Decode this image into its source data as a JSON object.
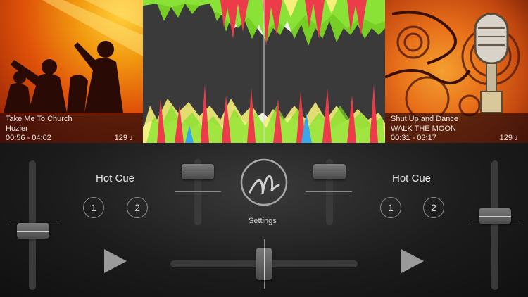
{
  "deck_left": {
    "title": "Take Me To Church",
    "artist": "Hozier",
    "time": "00:56 - 04:02",
    "bpm": "129 ♩",
    "hot_cue_label": "Hot Cue",
    "cue_1": "1",
    "cue_2": "2",
    "pitch_level": 0.45
  },
  "deck_right": {
    "title": "Shut Up and Dance",
    "artist": "WALK THE MOON",
    "time": "00:31 - 03:17",
    "bpm": "129 ♩",
    "hot_cue_label": "Hot Cue",
    "cue_1": "1",
    "cue_2": "2",
    "pitch_level": 0.58
  },
  "center": {
    "settings_label": "Settings",
    "crossfader_position": 0.5,
    "channel_left_volume": 0.9,
    "channel_right_volume": 0.9
  },
  "colors": {
    "wave_red": "#ec3c4a",
    "wave_green": "#7ee024",
    "wave_yellow": "#f4f07a",
    "wave_blue": "#3aa8e8",
    "wave_white": "#f2f2e8"
  }
}
